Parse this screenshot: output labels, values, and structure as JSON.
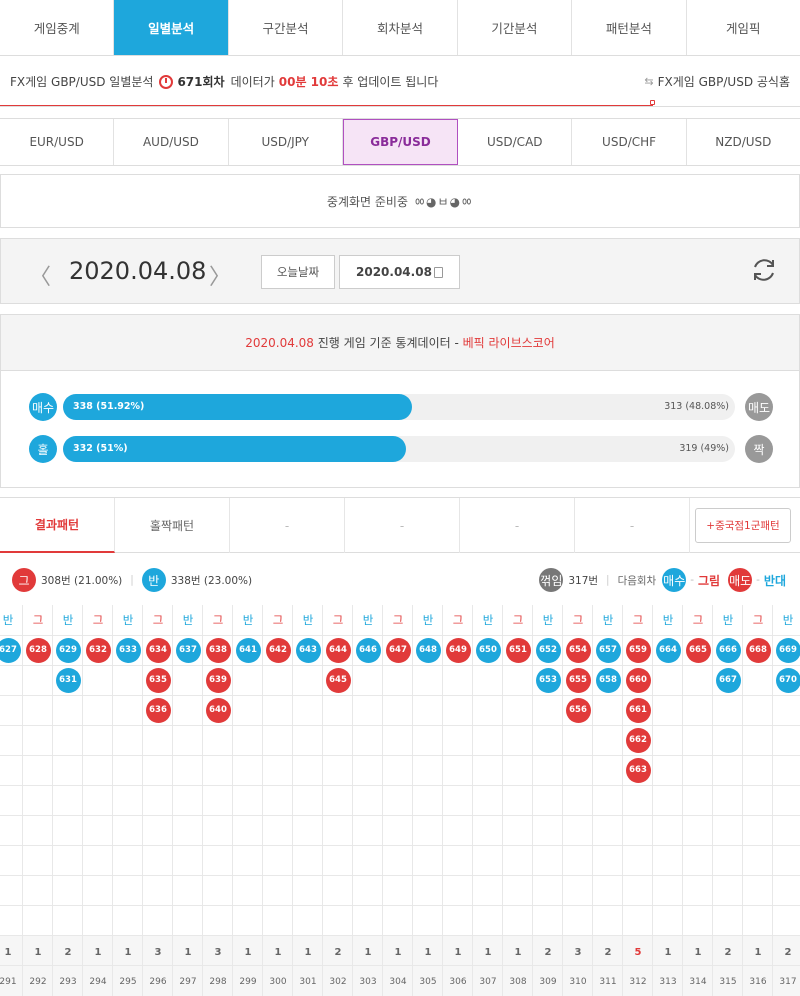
{
  "nav": {
    "tabs": [
      {
        "label": "게임중계",
        "active": false
      },
      {
        "label": "일별분석",
        "active": true
      },
      {
        "label": "구간분석",
        "active": false
      },
      {
        "label": "회차분석",
        "active": false
      },
      {
        "label": "기간분석",
        "active": false
      },
      {
        "label": "패턴분석",
        "active": false
      },
      {
        "label": "게임픽",
        "active": false
      }
    ]
  },
  "info": {
    "prefix": "FX게임 GBP/USD 일별분석",
    "round": "671회차",
    "mid": "데이터가",
    "countdown": "00분 10초",
    "suffix": "후 업데이트 됩니다",
    "home_link": "FX게임 GBP/USD 공식홈"
  },
  "currencies": [
    {
      "label": "EUR/USD",
      "active": false
    },
    {
      "label": "AUD/USD",
      "active": false
    },
    {
      "label": "USD/JPY",
      "active": false
    },
    {
      "label": "GBP/USD",
      "active": true
    },
    {
      "label": "USD/CAD",
      "active": false
    },
    {
      "label": "USD/CHF",
      "active": false
    },
    {
      "label": "NZD/USD",
      "active": false
    }
  ],
  "relay": {
    "text": "중계화면 준비중",
    "emoticon": "ㆀ◕ㅂ◕ㆀ"
  },
  "datebar": {
    "prev": "〈",
    "date": "2020.04.08",
    "next": "〉",
    "today_label": "오늘날짜",
    "input_value": "2020.04.08"
  },
  "stats": {
    "date": "2020.04.08",
    "desc": "진행 게임 기준 통계데이터 -",
    "source": "베픽 라이브스코어",
    "rows": [
      {
        "left_label": "매수",
        "right_label": "매도",
        "left_text": "338 (51.92%)",
        "right_text": "313 (48.08%)",
        "left_pct": 51.92
      },
      {
        "left_label": "홀",
        "right_label": "짝",
        "left_text": "332 (51%)",
        "right_text": "319 (49%)",
        "left_pct": 51
      }
    ]
  },
  "pattern_tabs": {
    "tabs": [
      "결과패턴",
      "홀짝패턴",
      "-",
      "-",
      "-",
      "-"
    ],
    "button": "+중국점1군패턴"
  },
  "legend": {
    "red_symbol": "그",
    "red_text": "308번 (21.00%)",
    "blue_symbol": "반",
    "blue_text": "338번 (23.00%)",
    "turn_symbol": "꺾임",
    "turn_text": "317번",
    "next_round": "다음회차",
    "buy_symbol": "매수",
    "buy_result": "그림",
    "sell_symbol": "매도",
    "sell_result": "반대"
  },
  "grid": {
    "columns": [
      {
        "head": "반",
        "color": "blue",
        "balls": [
          "627"
        ],
        "count": "1",
        "num": "291"
      },
      {
        "head": "그",
        "color": "red",
        "balls": [
          "628"
        ],
        "count": "1",
        "num": "292"
      },
      {
        "head": "반",
        "color": "blue",
        "balls": [
          "629",
          "631"
        ],
        "count": "2",
        "num": "293"
      },
      {
        "head": "그",
        "color": "red",
        "balls": [
          "632"
        ],
        "count": "1",
        "num": "294"
      },
      {
        "head": "반",
        "color": "blue",
        "balls": [
          "633"
        ],
        "count": "1",
        "num": "295"
      },
      {
        "head": "그",
        "color": "red",
        "balls": [
          "634",
          "635",
          "636"
        ],
        "count": "3",
        "num": "296"
      },
      {
        "head": "반",
        "color": "blue",
        "balls": [
          "637"
        ],
        "count": "1",
        "num": "297"
      },
      {
        "head": "그",
        "color": "red",
        "balls": [
          "638",
          "639",
          "640"
        ],
        "count": "3",
        "num": "298"
      },
      {
        "head": "반",
        "color": "blue",
        "balls": [
          "641"
        ],
        "count": "1",
        "num": "299"
      },
      {
        "head": "그",
        "color": "red",
        "balls": [
          "642"
        ],
        "count": "1",
        "num": "300"
      },
      {
        "head": "반",
        "color": "blue",
        "balls": [
          "643"
        ],
        "count": "1",
        "num": "301"
      },
      {
        "head": "그",
        "color": "red",
        "balls": [
          "644",
          "645"
        ],
        "count": "2",
        "num": "302"
      },
      {
        "head": "반",
        "color": "blue",
        "balls": [
          "646"
        ],
        "count": "1",
        "num": "303"
      },
      {
        "head": "그",
        "color": "red",
        "balls": [
          "647"
        ],
        "count": "1",
        "num": "304"
      },
      {
        "head": "반",
        "color": "blue",
        "balls": [
          "648"
        ],
        "count": "1",
        "num": "305"
      },
      {
        "head": "그",
        "color": "red",
        "balls": [
          "649"
        ],
        "count": "1",
        "num": "306"
      },
      {
        "head": "반",
        "color": "blue",
        "balls": [
          "650"
        ],
        "count": "1",
        "num": "307"
      },
      {
        "head": "그",
        "color": "red",
        "balls": [
          "651"
        ],
        "count": "1",
        "num": "308"
      },
      {
        "head": "반",
        "color": "blue",
        "balls": [
          "652",
          "653"
        ],
        "count": "2",
        "num": "309"
      },
      {
        "head": "그",
        "color": "red",
        "balls": [
          "654",
          "655",
          "656"
        ],
        "count": "3",
        "num": "310"
      },
      {
        "head": "반",
        "color": "blue",
        "balls": [
          "657",
          "658"
        ],
        "count": "2",
        "num": "311"
      },
      {
        "head": "그",
        "color": "red",
        "balls": [
          "659",
          "660",
          "661",
          "662",
          "663"
        ],
        "count": "5",
        "num": "312"
      },
      {
        "head": "반",
        "color": "blue",
        "balls": [
          "664"
        ],
        "count": "1",
        "num": "313"
      },
      {
        "head": "그",
        "color": "red",
        "balls": [
          "665"
        ],
        "count": "1",
        "num": "314"
      },
      {
        "head": "반",
        "color": "blue",
        "balls": [
          "666",
          "667"
        ],
        "count": "2",
        "num": "315"
      },
      {
        "head": "그",
        "color": "red",
        "balls": [
          "668"
        ],
        "count": "1",
        "num": "316"
      },
      {
        "head": "반",
        "color": "blue",
        "balls": [
          "669",
          "670"
        ],
        "count": "2",
        "num": "317"
      }
    ]
  },
  "colors": {
    "blue": "#1ea7dc",
    "red": "#e13a3a",
    "gray": "#777777"
  }
}
